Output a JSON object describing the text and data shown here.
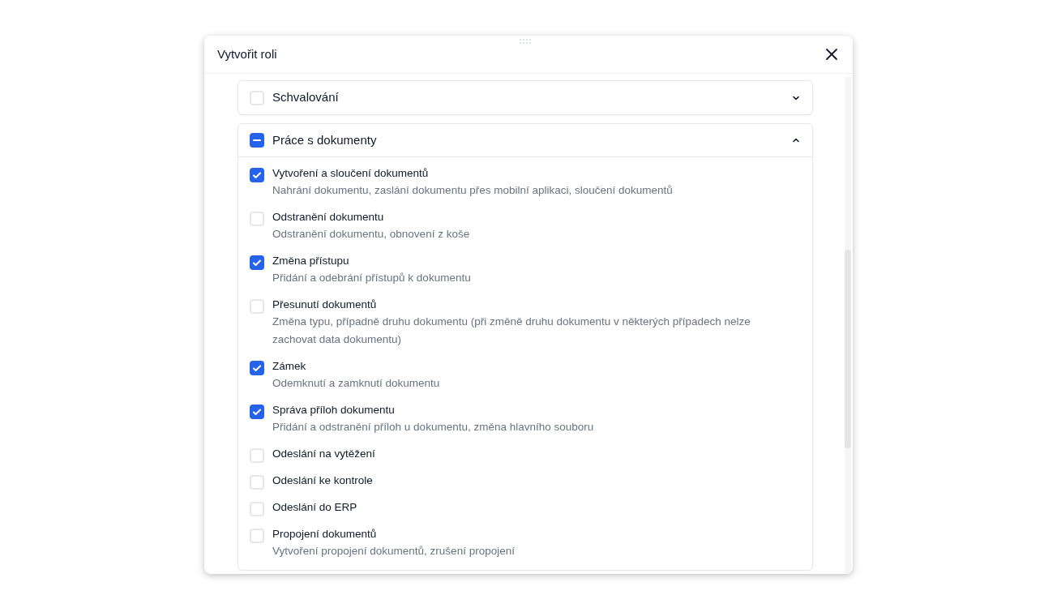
{
  "dialog": {
    "title": "Vytvořit roli"
  },
  "groups": [
    {
      "label": "Schvalování",
      "checked": false,
      "indeterminate": false,
      "expanded": false
    },
    {
      "label": "Práce s dokumenty",
      "indeterminate": true,
      "expanded": true,
      "items": [
        {
          "label": "Vytvoření a sloučení dokumentů",
          "description": "Nahrání dokumentu, zaslání dokumentu přes mobilní aplikaci, sloučení dokumentů",
          "checked": true
        },
        {
          "label": "Odstranění dokumentu",
          "description": "Odstranění dokumentu, obnovení z koše",
          "checked": false
        },
        {
          "label": "Změna přístupu",
          "description": "Přidání a odebrání přístupů k dokumentu",
          "checked": true
        },
        {
          "label": "Přesunutí dokumentů",
          "description": "Změna typu, případně druhu dokumentu (při změně druhu dokumentu v některých případech nelze zachovat data dokumentu)",
          "checked": false
        },
        {
          "label": "Zámek",
          "description": "Odemknutí a zamknutí dokumentu",
          "checked": true
        },
        {
          "label": "Správa příloh dokumentu",
          "description": "Přidání a odstranění příloh u dokumentu, změna hlavního souboru",
          "checked": true
        },
        {
          "label": "Odeslání na vytěžení",
          "checked": false
        },
        {
          "label": "Odeslání ke kontrole",
          "checked": false
        },
        {
          "label": "Odeslání do ERP",
          "checked": false
        },
        {
          "label": "Propojení dokumentů",
          "description": "Vytvoření propojení dokumentů, zrušení propojení",
          "checked": false
        }
      ]
    }
  ]
}
